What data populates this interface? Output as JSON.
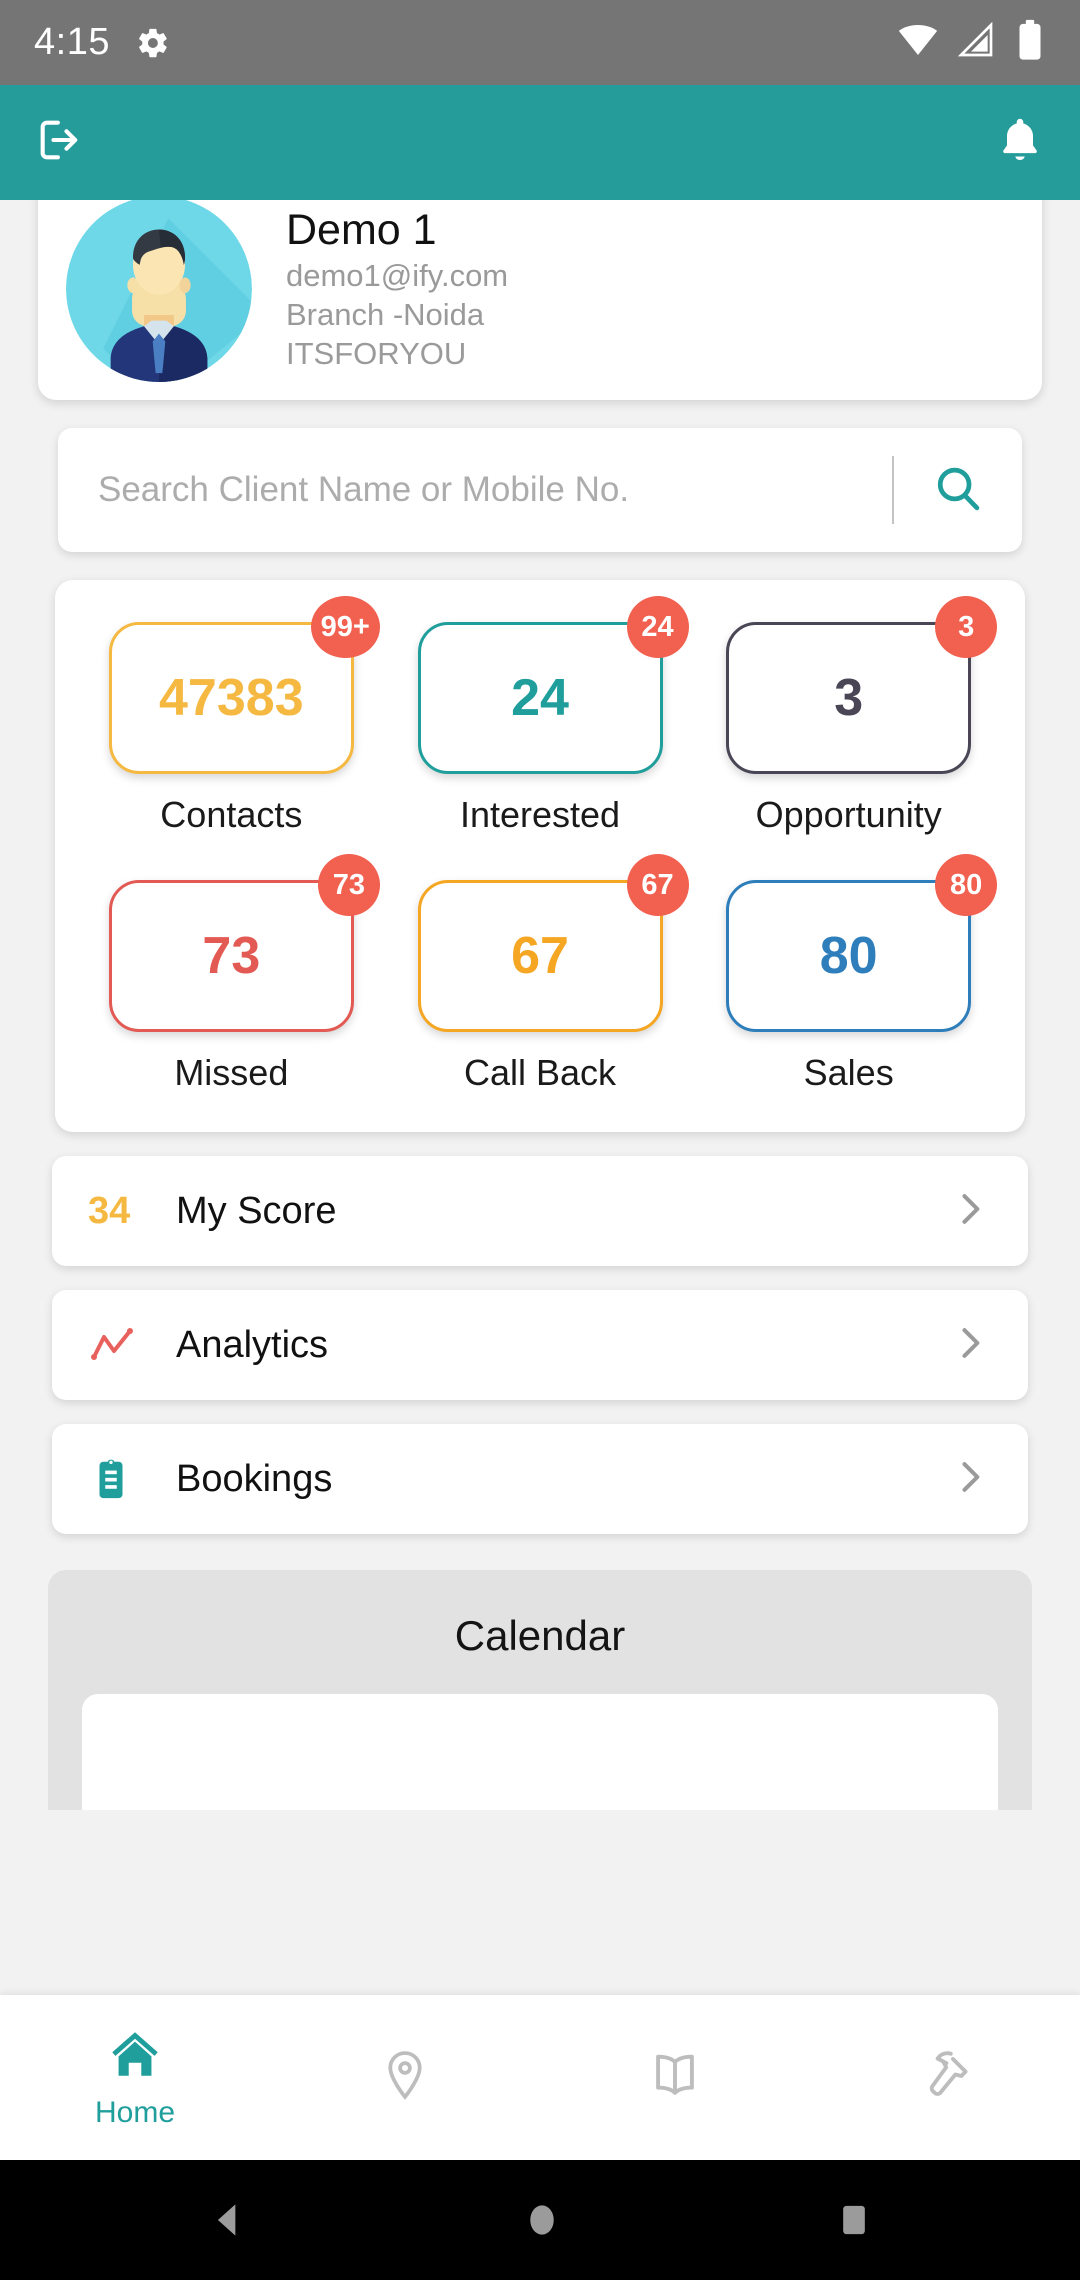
{
  "statusbar": {
    "time": "4:15",
    "icons": [
      "gear-icon",
      "wifi-icon",
      "signal-icon",
      "battery-icon"
    ]
  },
  "appbar": {
    "logout_icon": "logout-icon",
    "notification_icon": "bell-icon",
    "bg_color": "#259B9A"
  },
  "profile": {
    "name": "Demo 1",
    "email": "demo1@ify.com",
    "branch": "Branch -Noida",
    "org": "ITSFORYOU",
    "avatar": "user-avatar"
  },
  "search": {
    "value": "",
    "placeholder": "Search Client Name or Mobile No.",
    "button_icon": "search-icon"
  },
  "stats": {
    "rows": [
      [
        {
          "label": "Contacts",
          "value": "47383",
          "badge": "99+",
          "color": "#F5B841"
        },
        {
          "label": "Interested",
          "value": "24",
          "badge": "24",
          "color": "#1F9E9C"
        },
        {
          "label": "Opportunity",
          "value": "3",
          "badge": "3",
          "color": "#4A4656"
        }
      ],
      [
        {
          "label": "Missed",
          "value": "73",
          "badge": "73",
          "color": "#E25A53"
        },
        {
          "label": "Call Back",
          "value": "67",
          "badge": "67",
          "color": "#F5A623"
        },
        {
          "label": "Sales",
          "value": "80",
          "badge": "80",
          "color": "#2E7EBB"
        }
      ]
    ],
    "badge_color": "#F2604F"
  },
  "menu": [
    {
      "label": "My Score",
      "score": "34",
      "icon": "score-number",
      "chevron": "chevron-right-icon"
    },
    {
      "label": "Analytics",
      "score": "",
      "icon": "line-chart-icon",
      "chevron": "chevron-right-icon"
    },
    {
      "label": "Bookings",
      "score": "",
      "icon": "clipboard-icon",
      "chevron": "chevron-right-icon"
    }
  ],
  "calendar": {
    "title": "Calendar"
  },
  "bottomnav": {
    "items": [
      {
        "label": "Home",
        "icon": "home-icon",
        "active": true
      },
      {
        "label": "",
        "icon": "location-icon",
        "active": false
      },
      {
        "label": "",
        "icon": "book-icon",
        "active": false
      },
      {
        "label": "",
        "icon": "hammer-icon",
        "active": false
      }
    ],
    "active_color": "#1F9E9C",
    "inactive_color": "#BDBDBD"
  },
  "androidnav": {
    "buttons": [
      "back-button",
      "home-button",
      "recents-button"
    ]
  }
}
